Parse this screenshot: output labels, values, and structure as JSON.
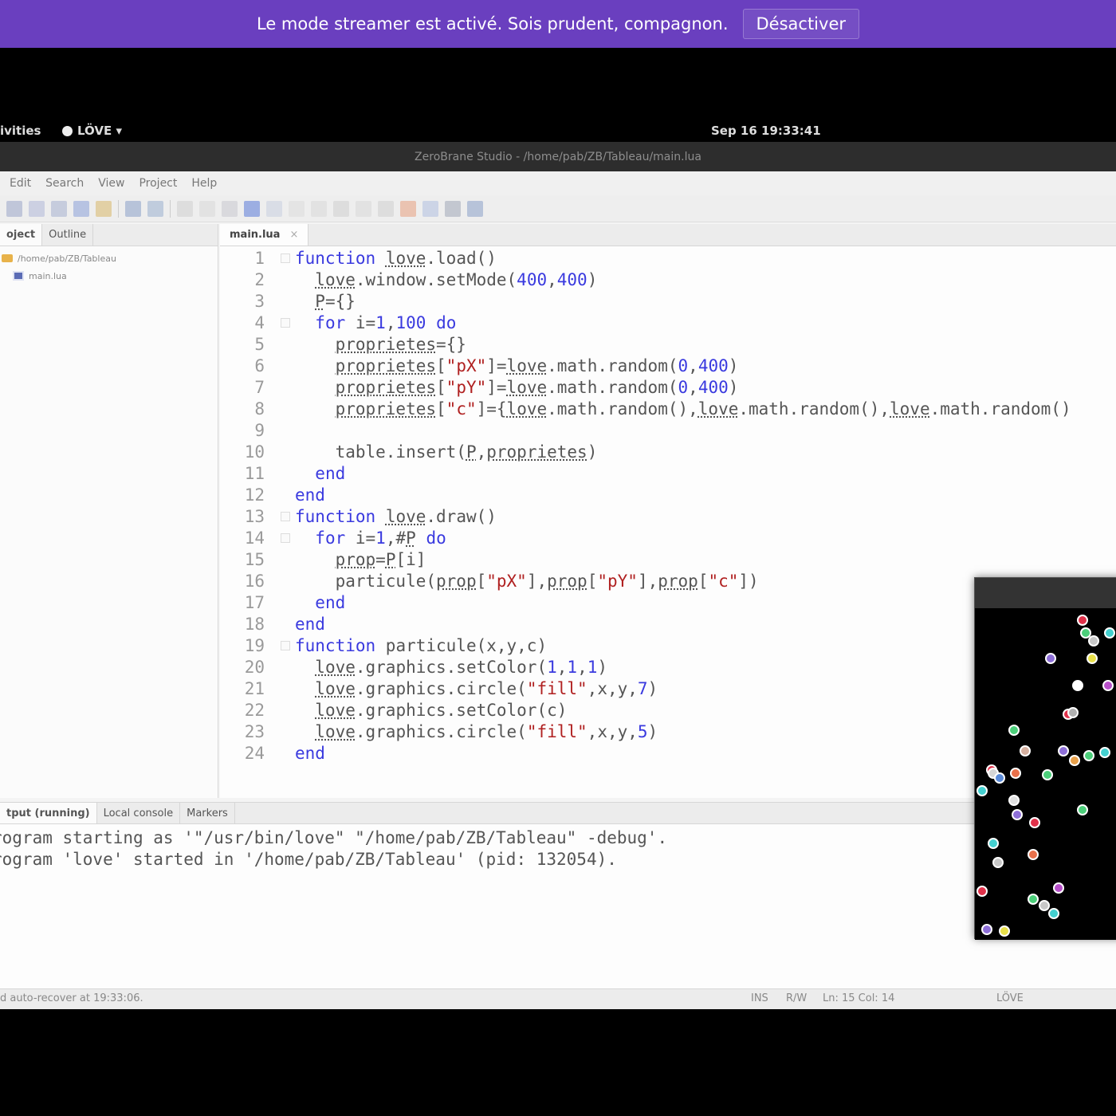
{
  "banner": {
    "message": "Le mode streamer est activé. Sois prudent, compagnon.",
    "button_label": "Désactiver"
  },
  "system_bar": {
    "activities": "ivities",
    "app_name": "LÖVE ▾",
    "clock": "Sep 16  19:33:41"
  },
  "window": {
    "title": "ZeroBrane Studio - /home/pab/ZB/Tableau/main.lua"
  },
  "menu": [
    "Edit",
    "Search",
    "View",
    "Project",
    "Help"
  ],
  "project_panel": {
    "tabs": [
      "oject",
      "Outline"
    ],
    "tree": {
      "folder": "/home/pab/ZB/Tableau",
      "file": "main.lua"
    }
  },
  "editor": {
    "tab_label": "main.lua",
    "close_icon": "×",
    "line_numbers": [
      "1",
      "2",
      "3",
      "4",
      "5",
      "6",
      "7",
      "8",
      "9",
      "10",
      "11",
      "12",
      "13",
      "14",
      "15",
      "16",
      "17",
      "18",
      "19",
      "20",
      "21",
      "22",
      "23",
      "24"
    ],
    "lines": [
      "function love.load()",
      "  love.window.setMode(400,400)",
      "  P={}",
      "  for i=1,100 do",
      "    proprietes={}",
      "    proprietes[\"pX\"]=love.math.random(0,400)",
      "    proprietes[\"pY\"]=love.math.random(0,400)",
      "    proprietes[\"c\"]={love.math.random(),love.math.random(),love.math.random()",
      "",
      "    table.insert(P,proprietes)",
      "  end",
      "end",
      "function love.draw()",
      "  for i=1,#P do",
      "    prop=P[i]",
      "    particule(prop[\"pX\"],prop[\"pY\"],prop[\"c\"])",
      "  end",
      "end",
      "function particule(x,y,c)",
      "  love.graphics.setColor(1,1,1)",
      "  love.graphics.circle(\"fill\",x,y,7)",
      "  love.graphics.setColor(c)",
      "  love.graphics.circle(\"fill\",x,y,5)",
      "end"
    ]
  },
  "bottom_panel": {
    "tabs": [
      "tput (running)",
      "Local console",
      "Markers"
    ],
    "output": [
      "rogram starting as '\"/usr/bin/love\" \"/home/pab/ZB/Tableau\" -debug'.",
      "rogram 'love' started in '/home/pab/ZB/Tableau' (pid: 132054)."
    ]
  },
  "status": {
    "message": "d auto-recover at 19:33:06.",
    "ins": "INS",
    "rw": "R/W",
    "position": "Ln: 15 Col: 14",
    "interpreter": "LÖVE"
  },
  "colors": {
    "banner": "#6a3fbf",
    "keyword": "#3a3adf",
    "string": "#b02020"
  },
  "particles": [
    {
      "color": "#e0314a"
    },
    {
      "color": "#4ccf7a"
    },
    {
      "color": "#c8c8c8"
    },
    {
      "color": "#43d0d0"
    },
    {
      "color": "#8e6fd8"
    },
    {
      "color": "#e8e04a"
    },
    {
      "color": "#ffffff"
    },
    {
      "color": "#b74fc9"
    },
    {
      "color": "#e0314a"
    },
    {
      "color": "#b0b0b0"
    },
    {
      "color": "#4ccf7a"
    },
    {
      "color": "#d6b0a0"
    },
    {
      "color": "#8e6fd8"
    },
    {
      "color": "#e8a04a"
    },
    {
      "color": "#4ccf7a"
    },
    {
      "color": "#43d0d0"
    },
    {
      "color": "#e0314a"
    },
    {
      "color": "#d6d6d6"
    },
    {
      "color": "#5a8ad8"
    },
    {
      "color": "#e8704a"
    },
    {
      "color": "#4ccf7a"
    },
    {
      "color": "#43d0d0"
    },
    {
      "color": "#e0e0e0"
    },
    {
      "color": "#4ccf7a"
    },
    {
      "color": "#8e6fd8"
    },
    {
      "color": "#e0314a"
    },
    {
      "color": "#43d0d0"
    },
    {
      "color": "#c8c8c8"
    },
    {
      "color": "#e8704a"
    },
    {
      "color": "#b74fc9"
    }
  ]
}
